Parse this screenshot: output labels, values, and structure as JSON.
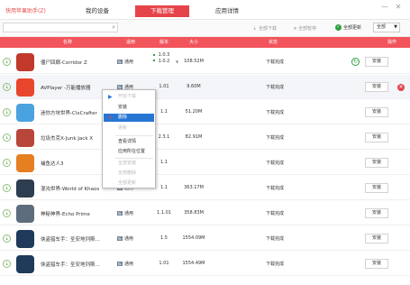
{
  "titlebar": {
    "app_name": "快用苹果助手(Z)",
    "tabs": [
      {
        "label": "我的设备"
      },
      {
        "label": "下载管理"
      },
      {
        "label": "应用详情"
      }
    ],
    "controls": {
      "minimize": "—",
      "close": "✕"
    }
  },
  "toolbar": {
    "search_placeholder": "",
    "all_downloads": "全部下载",
    "all_pause": "全部暂停",
    "all_update": "全部更新",
    "filter_value": "全部"
  },
  "table": {
    "headers": {
      "name": "名称",
      "compat": "适用",
      "version": "版本",
      "size": "大小",
      "status": "状态",
      "action": "操作"
    },
    "rows": [
      {
        "name": "僵尸回廊-Corridor Z",
        "tag": "标",
        "compat": "通用",
        "version_top": "1.0.3",
        "version_bottom": "1.0.2",
        "size": "108.52M",
        "status": "下载完成",
        "action": "安装",
        "icon_color": "#c0392b",
        "has_refresh": true
      },
      {
        "name": "AVPlayer -万能播放器",
        "tag": "标",
        "compat": "通用",
        "version": "1.01",
        "size": "9.60M",
        "status": "下载完成",
        "action": "安装",
        "icon_color": "#e8472d"
      },
      {
        "name": "迷你方块世界-ClxCrafter",
        "tag": "标",
        "compat": "通用",
        "version": "1.1",
        "size": "51.20M",
        "status": "下载完成",
        "action": "安装",
        "icon_color": "#4aa3df"
      },
      {
        "name": "垃圾杰克X-Junk Jack X",
        "tag": "标",
        "compat": "通用",
        "version": "2.3.1",
        "size": "82.91M",
        "status": "下载完成",
        "action": "安装",
        "icon_color": "#b8463a"
      },
      {
        "name": "捕鱼达人3",
        "tag": "标",
        "compat": "通用",
        "version": "1.1",
        "size": "",
        "status": "下载完成",
        "action": "安装",
        "icon_color": "#e67e22"
      },
      {
        "name": "混沌世界-World of Khaos",
        "tag": "标",
        "compat": "通用",
        "version": "1.1",
        "size": "363.17M",
        "status": "下载完成",
        "action": "安装",
        "icon_color": "#2c3e50"
      },
      {
        "name": "神秘神界-Echo Prime",
        "tag": "标",
        "compat": "通用",
        "version": "1.1.01",
        "size": "358.83M",
        "status": "下载完成",
        "action": "安装",
        "icon_color": "#5d6d7e"
      },
      {
        "name": "侠盗猎车手：圣安地列斯...",
        "tag": "标",
        "compat": "通用",
        "version": "1.5",
        "size": "1554.09M",
        "status": "下载完成",
        "action": "安装",
        "icon_color": "#1f3a5a"
      },
      {
        "name": "侠盗猎车手：圣安地列斯...",
        "tag": "标",
        "compat": "通用",
        "version": "1.01",
        "size": "1554.49M",
        "status": "下载完成",
        "action": "安装",
        "icon_color": "#1f3a5a"
      }
    ]
  },
  "context_menu": {
    "items": [
      {
        "label": "开始下载",
        "icon": "▶",
        "state": "disabled"
      },
      {
        "label": "安装",
        "icon": "",
        "state": "normal"
      },
      {
        "label": "删除",
        "icon": "✕",
        "state": "selected"
      },
      {
        "label": "更新",
        "icon": "",
        "state": "disabled"
      },
      {
        "label": "查看详情",
        "icon": "",
        "state": "normal"
      },
      {
        "label": "应用所在位置",
        "icon": "",
        "state": "normal"
      },
      {
        "label": "全部安装",
        "icon": "",
        "state": "disabled"
      },
      {
        "label": "全部删除",
        "icon": "",
        "state": "disabled"
      },
      {
        "label": "全部更新",
        "icon": "",
        "state": "disabled"
      }
    ]
  },
  "colors": {
    "brand_red": "#f2545b",
    "active_tab": "#e5454a",
    "menu_highlight": "#2876d4",
    "success_green": "#2f9e3f"
  }
}
